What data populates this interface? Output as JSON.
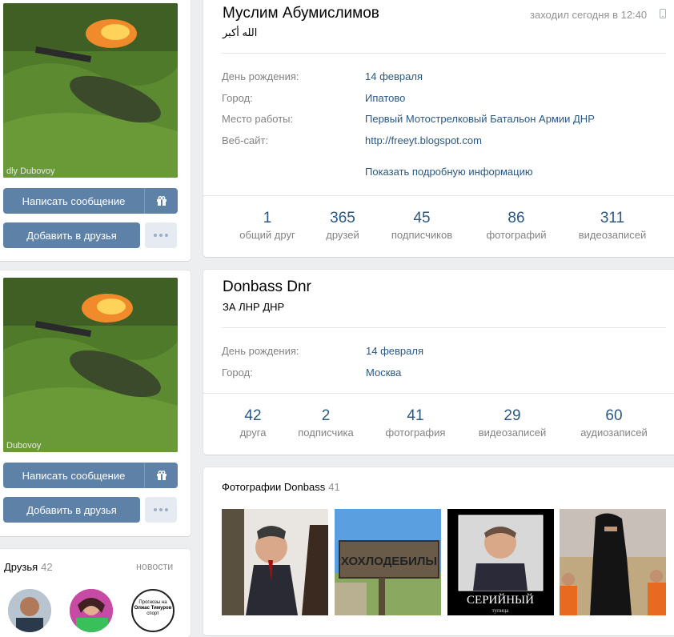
{
  "profile1": {
    "name": "Муслим Абумислимов",
    "status": "الله أكبر",
    "online": "заходил сегодня в 12:40",
    "photo_watermark": "dly Dubovoy",
    "details": [
      {
        "label": "День рождения:",
        "value": "14 февраля"
      },
      {
        "label": "Город:",
        "value": "Ипатово"
      },
      {
        "label": "Место работы:",
        "value": "Первый Мотострелковый Батальон Армии ДНР"
      },
      {
        "label": "Веб-сайт:",
        "value": "http://freeyt.blogspot.com"
      }
    ],
    "more_link": "Показать подробную информацию",
    "counters": [
      {
        "num": "1",
        "label": "общий друг"
      },
      {
        "num": "365",
        "label": "друзей"
      },
      {
        "num": "45",
        "label": "подписчиков"
      },
      {
        "num": "86",
        "label": "фотографий"
      },
      {
        "num": "311",
        "label": "видеозаписей"
      }
    ],
    "message_button": "Написать сообщение",
    "add_friend_button": "Добавить в друзья"
  },
  "profile2": {
    "name": "Donbass Dnr",
    "status": "ЗА ЛНР ДНР",
    "photo_watermark": "Dubovoy",
    "details": [
      {
        "label": "День рождения:",
        "value": "14 февраля"
      },
      {
        "label": "Город:",
        "value": "Москва"
      }
    ],
    "counters": [
      {
        "num": "42",
        "label": "друга"
      },
      {
        "num": "2",
        "label": "подписчика"
      },
      {
        "num": "41",
        "label": "фотография"
      },
      {
        "num": "29",
        "label": "видеозаписей"
      },
      {
        "num": "60",
        "label": "аудиозаписей"
      }
    ],
    "message_button": "Написать сообщение",
    "add_friend_button": "Добавить в друзья"
  },
  "friends": {
    "title": "Друзья",
    "count": "42",
    "news_link": "новости",
    "avatar3_text": [
      "Прогнозы на",
      "Олжас Тимуров",
      "спорт"
    ]
  },
  "photos": {
    "title": "Фотографии Donbass",
    "count": "41",
    "thumb2_text": "ХОХЛОДЕБИЛЫ",
    "thumb3_text": "СЕРИЙНЫЙ",
    "thumb3_sub": "тупица"
  },
  "colors": {
    "link": "#2a5885",
    "button": "#5e81a8",
    "background": "#edeef0"
  },
  "icons": [
    "gift-icon",
    "more-icon",
    "phone-icon"
  ]
}
